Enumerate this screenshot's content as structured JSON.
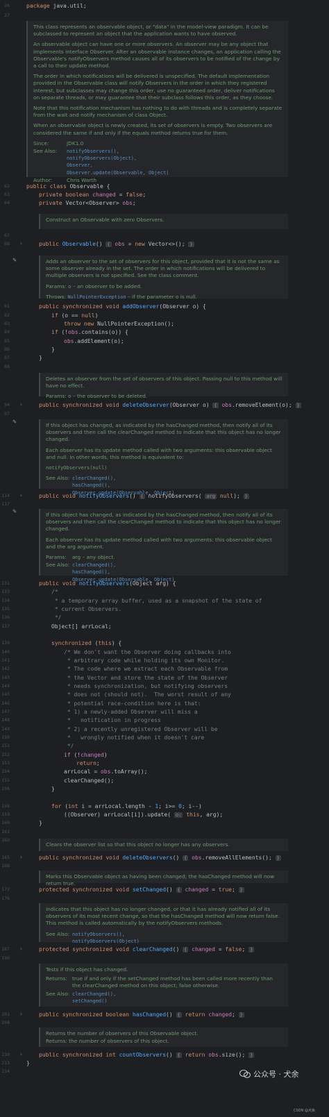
{
  "editor": {
    "header_line": "package java.util;",
    "doc_class": {
      "paras": [
        "This class represents an observable object, or \"data\" in the model-view paradigm. It can be subclassed to represent an object that the application wants to have observed.",
        "An observable object can have one or more observers. An observer may be any object that implements interface Observer. After an observable instance changes, an application calling the Observable's notifyObservers method causes all of its observers to be notified of the change by a call to their update method.",
        "The order in which notifications will be delivered is unspecified. The default implementation provided in the Observable class will notify Observers in the order in which they registered interest, but subclasses may change this order, use no guaranteed order, deliver notifications on separate threads, or may guarantee that their subclass follows this order, as they choose.",
        "Note that this notification mechanism has nothing to do with threads and is completely separate from the wait and notify mechanism of class Object.",
        "When an observable object is newly created, its set of observers is empty. Two observers are considered the same if and only if the equals method returns true for them."
      ],
      "since_label": "Since:",
      "since_value": "JDK1.0",
      "see_label": "See Also:",
      "see_values": "notifyObservers(),\nnotifyObservers(Object),\nObserver,\nObserver.update(Observable, Object)",
      "author_label": "Author:",
      "author_value": "Chris Warth"
    },
    "doc_ctor": "Construct an Observable with zero Observers.",
    "doc_add": {
      "text": "Adds an observer to the set of observers for this object, provided that it is not the same as some observer already in the set. The order in which notifications will be delivered to multiple observers is not specified. See the class comment.",
      "params": "Params:  o – an observer to be added.",
      "throws_label": "Throws: ",
      "throws_link": "NullPointerException",
      "throws_rest": " – if the parameter o is null."
    },
    "doc_delete": {
      "text": "Deletes an observer from the set of observers of this object. Passing null to this method will have no effect.",
      "params": "Params:  o – the observer to be deleted."
    },
    "doc_notify0": {
      "p1": "If this object has changed, as indicated by the hasChanged method, then notify all of its observers and then call the clearChanged method to indicate that this object has no longer changed.",
      "p2": "Each observer has its update method called with two arguments: this observable object and null. In other words, this method is equivalent to:",
      "code": "notifyObservers(null)",
      "see_label": "See Also:",
      "see_values": "clearChanged(),\nhasChanged(),\nObserver.update(Observable, Object)"
    },
    "doc_notify1": {
      "p1": "If this object has changed, as indicated by the hasChanged method, then notify all of its observers and then call the clearChanged method to indicate that this object has no longer changed.",
      "p2": "Each observer has its update method called with two arguments: this observable object and the arg argument.",
      "params_label": "Params:",
      "params_value": "arg – any object.",
      "see_label": "See Also:",
      "see_values": "clearChanged(),\nhasChanged(),\nObserver.update(Observable, Object)"
    },
    "doc_deleteall": "Clears the observer list so that this object no longer has any observers.",
    "doc_setchanged": "Marks this Observable object as having been changed; the hasChanged method will now return true.",
    "doc_clearchanged": {
      "text": "Indicates that this object has no longer changed, or that it has already notified all of its observers of its most recent change, so that the hasChanged method will now return false. This method is called automatically by the notifyObservers methods.",
      "see_label": "See Also:",
      "see_values": "notifyObservers(),\nnotifyObservers(Object)"
    },
    "doc_haschanged": {
      "returns_label": "Returns:",
      "returns_value": "true if and only if the setChanged method has been called more recently than the clearChanged method on this object; false otherwise.",
      "see_label": "See Also:",
      "see_values": "clearChanged(),\nsetChanged()"
    },
    "doc_count": {
      "text": "Returns the number of observers of this Observable object.",
      "returns": "Returns: the number of observers of this object."
    },
    "line_numbers": [
      "26",
      "27",
      "62",
      "63",
      "64",
      "67",
      "68",
      "81",
      "82",
      "83",
      "84",
      "85",
      "86",
      "87",
      "88",
      "94",
      "97",
      "114",
      "117",
      "131",
      "133",
      "134",
      "135",
      "136",
      "137",
      "139",
      "140",
      "141",
      "142",
      "143",
      "144",
      "145",
      "146",
      "147",
      "148",
      "149",
      "150",
      "151",
      "152",
      "153",
      "154",
      "155",
      "156",
      "158",
      "159",
      "160",
      "161",
      "163",
      "165",
      "168",
      "173",
      "176",
      "187",
      "190",
      "201",
      "204",
      "210",
      "213",
      "214"
    ]
  },
  "watermark": {
    "text": "公众号 · 犬余",
    "small": "CSDN @犬余"
  }
}
